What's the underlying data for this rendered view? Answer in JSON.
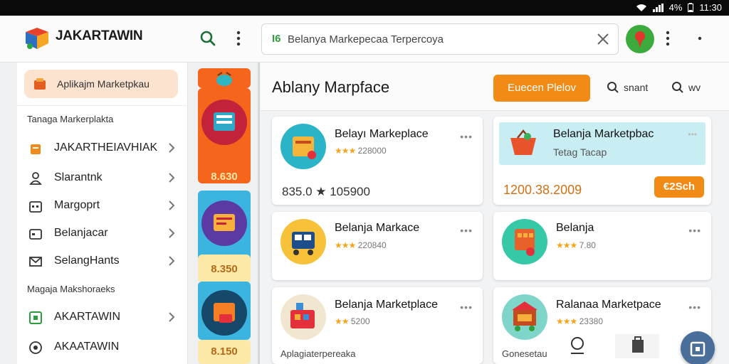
{
  "status_bar": {
    "battery": "4%",
    "time": "11:30"
  },
  "app": {
    "title": "JAKARTAWIN"
  },
  "search": {
    "prefix": "I6",
    "query": "Belanya Markepecaa Terpercoya"
  },
  "sidebar": {
    "chip_label": "Aplikajm Marketpkau",
    "section1": "Tanaga Markerplakta",
    "items1": [
      {
        "label": "JAKARTHEIAVHIAK",
        "icon": "store-icon"
      },
      {
        "label": "Slarantnk",
        "icon": "person-icon"
      },
      {
        "label": "Margoprt",
        "icon": "calendar-icon"
      },
      {
        "label": "Belanjacar",
        "icon": "card-icon"
      },
      {
        "label": "SelangHants",
        "icon": "mail-icon"
      }
    ],
    "section2": "Magaja Makshoraeks",
    "items2": [
      {
        "label": "AKARTAWIN",
        "icon": "app-icon"
      },
      {
        "label": "AKAATAWIN",
        "icon": "settings-icon"
      }
    ]
  },
  "categories": [
    {
      "price": "8.630",
      "bg": "#f5651c"
    },
    {
      "price": "8.350",
      "bg": "#fde9a7"
    },
    {
      "price": "8.150",
      "bg": "#fde9a7"
    }
  ],
  "main": {
    "title": "Ablany Marpface",
    "button": "Euecen Plelov",
    "link1": "snant",
    "link2": "wv"
  },
  "cards": [
    {
      "title": "Belayı Markeplace",
      "rating": "228000",
      "bottom": "835.0 ★ 105900",
      "thumb": "#2bb3c8"
    },
    {
      "title": "Belanja Marketpbac",
      "subtitle": "Tetag Tacap",
      "bottom": "1200.38.2009",
      "badge": "€2Sch",
      "thumb": "#e9532b"
    },
    {
      "title": "Belanja Markace",
      "rating": "220840",
      "thumb": "#f7c23a"
    },
    {
      "title": "Belanja",
      "rating": "7.80",
      "thumb": "#37c8a8"
    },
    {
      "title": "Belanja Marketplace",
      "rating": "5200",
      "bottom": "Aplagiaterpereaka",
      "thumb": "#f1e6cf"
    },
    {
      "title": "Ralanaa Marketpace",
      "rating": "23380",
      "bottom": "Gonesetau",
      "thumb": "#7fd5c9"
    }
  ]
}
